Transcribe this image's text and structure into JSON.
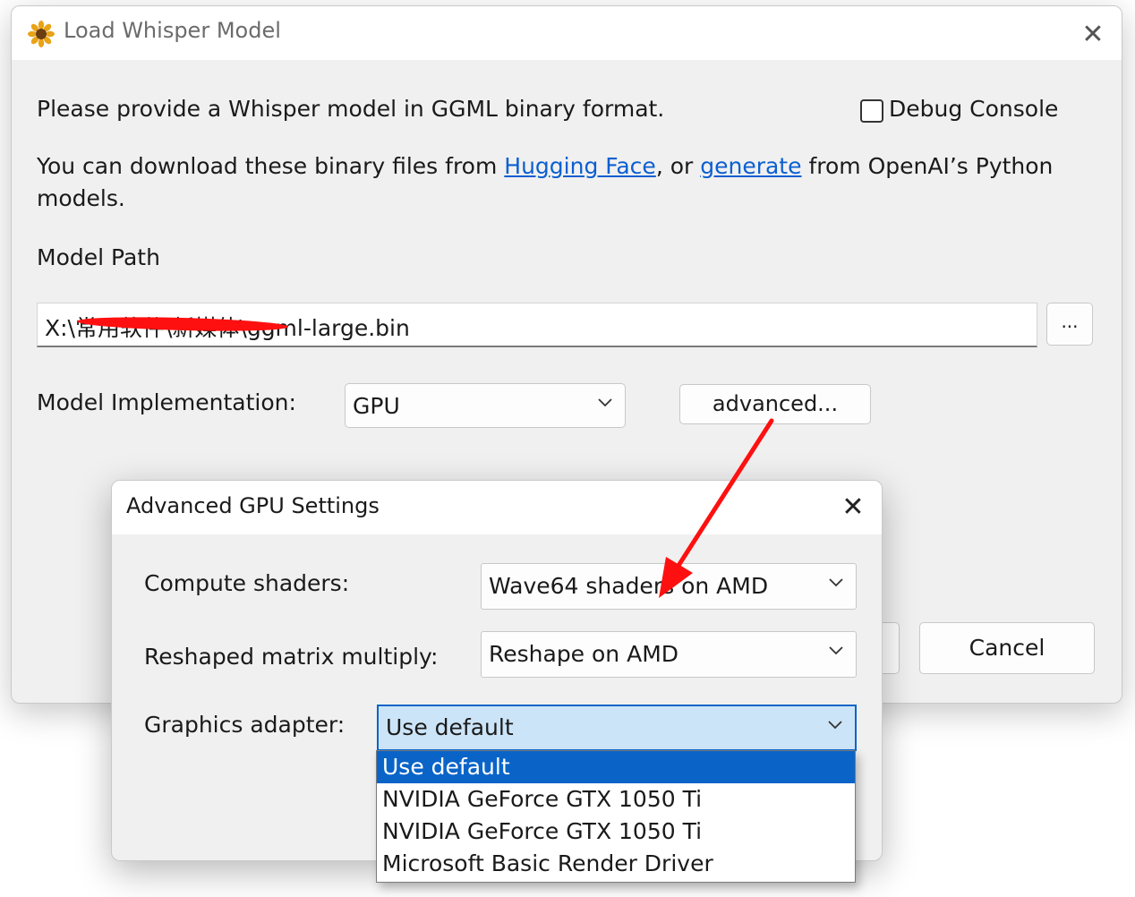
{
  "main_window": {
    "title": "Load Whisper Model",
    "close_glyph": "✕",
    "intro_text": "Please provide a Whisper model in GGML binary format.",
    "debug_console_label": "Debug Console",
    "download_text_before": "You can download these binary files from ",
    "hugging_face_link": "Hugging Face",
    "download_text_middle": ", or ",
    "generate_link": "generate",
    "download_text_after": " from OpenAI’s Python",
    "download_text_line2": "models.",
    "model_path_label": "Model Path",
    "model_path_value": "X:\\常用软件\\新媒体\\ggml-large.bin",
    "browse_button_label": "...",
    "implementation_label": "Model Implementation:",
    "implementation_value": "GPU",
    "advanced_button_label": "advanced...",
    "cancel_button_label": "Cancel"
  },
  "advanced_dialog": {
    "title": "Advanced GPU Settings",
    "close_glyph": "✕",
    "compute_shaders_label": "Compute shaders:",
    "compute_shaders_value": "Wave64 shaders on AMD",
    "reshaped_matmul_label": "Reshaped matrix multiply:",
    "reshaped_matmul_value": "Reshape on AMD",
    "graphics_adapter_label": "Graphics adapter:",
    "graphics_adapter_value": "Use default",
    "graphics_adapter_options": [
      "Use default",
      "NVIDIA GeForce GTX 1050 Ti",
      "NVIDIA GeForce GTX 1050 Ti",
      "Microsoft Basic Render Driver"
    ]
  },
  "icons": {
    "app_icon": "sunflower-icon",
    "dropdown_icon": "chevron-down-icon"
  },
  "colors": {
    "link": "#0b5fd1",
    "selection": "#0a64c8",
    "annotation_arrow": "#ff1010"
  }
}
